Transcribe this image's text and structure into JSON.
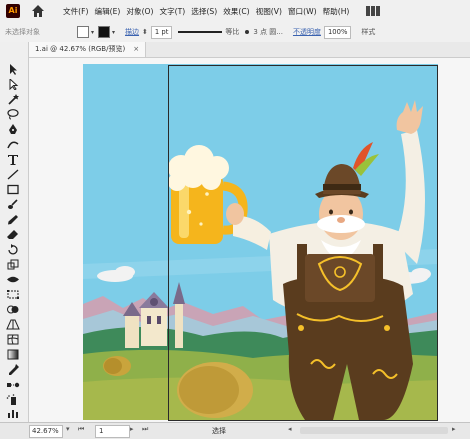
{
  "app": {
    "logo_text": "Ai"
  },
  "menu": [
    "文件(F)",
    "编辑(E)",
    "对象(O)",
    "文字(T)",
    "选择(S)",
    "效果(C)",
    "视图(V)",
    "窗口(W)",
    "帮助(H)"
  ],
  "control_bar": {
    "selection": "未选择对象",
    "stroke_label": "描边",
    "stroke_weight": "1 pt",
    "profile": "等比",
    "brush": "3 点 圆...",
    "opacity_label": "不透明度",
    "opacity_value": "100%",
    "style_label": "样式"
  },
  "document_tab": {
    "title": "1.ai @ 42.67% (RGB/预览)",
    "close": "×"
  },
  "status_bar": {
    "zoom": "42.67%",
    "page": "1",
    "selection_tool": "选择"
  },
  "icons": [
    "home-icon",
    "workspace-layout-icon",
    "selection-tool-icon",
    "direct-selection-icon",
    "magic-wand-icon",
    "lasso-icon",
    "pen-icon",
    "curvature-icon",
    "type-icon",
    "line-icon",
    "rectangle-icon",
    "paintbrush-icon",
    "pencil-icon",
    "eraser-icon",
    "rotate-icon",
    "scale-icon",
    "width-icon",
    "free-transform-icon",
    "shape-builder-icon",
    "perspective-icon",
    "mesh-icon",
    "gradient-icon",
    "eyedropper-icon",
    "blend-icon",
    "symbol-sprayer-icon",
    "column-graph-icon"
  ],
  "colors": {
    "sky": "#7dcde8",
    "grass": "#8fb04a",
    "beer": "#f5b51c",
    "lederhosen": "#5a3c1e",
    "hat_feather": "#e0542a"
  }
}
